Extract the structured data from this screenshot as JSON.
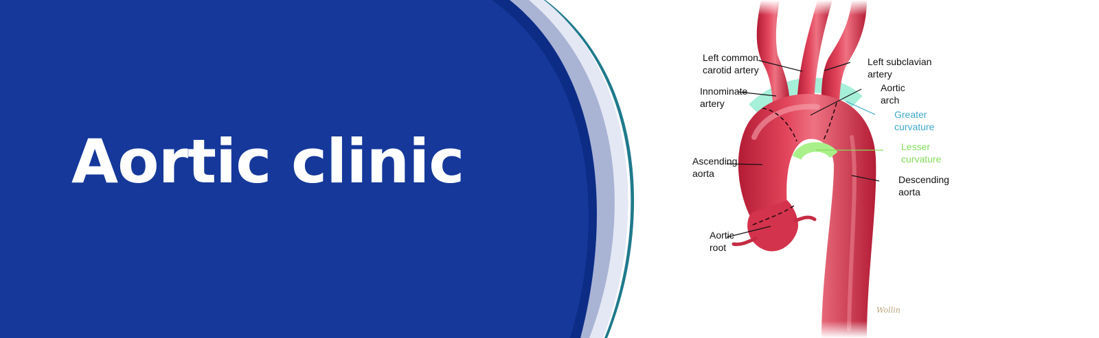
{
  "banner": {
    "title": "Aortic clinic"
  },
  "diagram": {
    "labels": {
      "left_common_carotid": [
        "Left common",
        "carotid artery"
      ],
      "left_subclavian": [
        "Left subclavian",
        "artery"
      ],
      "innominate": [
        "Innominate",
        "artery"
      ],
      "aortic_arch": [
        "Aortic",
        "arch"
      ],
      "greater_curvature": [
        "Greater",
        "curvature"
      ],
      "lesser_curvature": [
        "Lesser",
        "curvature"
      ],
      "ascending_aorta": [
        "Ascending",
        "aorta"
      ],
      "descending_aorta": [
        "Descending",
        "aorta"
      ],
      "aortic_root": [
        "Aortic",
        "root"
      ]
    },
    "signature": "Wollin"
  },
  "colors": {
    "navy": "#15389a",
    "navy_dark": "#0c2c86",
    "ring_light": "#a9b3d4",
    "ring_pale": "#e4e8f4",
    "teal_edge": "#1f7a8c",
    "aorta_red": "#d8304a",
    "greater_curvature": "#3fa7c9",
    "lesser_curvature": "#84dd5a"
  }
}
